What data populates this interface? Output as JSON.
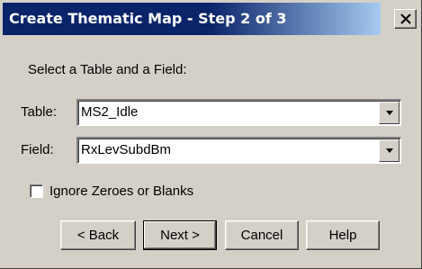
{
  "window": {
    "title": "Create Thematic Map - Step 2 of 3"
  },
  "form": {
    "prompt": "Select a Table and a Field:",
    "table_label": "Table:",
    "table_value": "MS2_Idle",
    "field_label": "Field:",
    "field_value": "RxLevSubdBm",
    "ignore_label": "Ignore Zeroes or Blanks",
    "ignore_checked": false
  },
  "buttons": {
    "back": "< Back",
    "next": "Next >",
    "cancel": "Cancel",
    "help": "Help"
  },
  "icons": {
    "close": "close-icon",
    "dropdown": "chevron-down-icon"
  },
  "colors": {
    "titlebar_start": "#0a246a",
    "titlebar_end": "#a6caf0",
    "face": "#d4d0c8"
  }
}
